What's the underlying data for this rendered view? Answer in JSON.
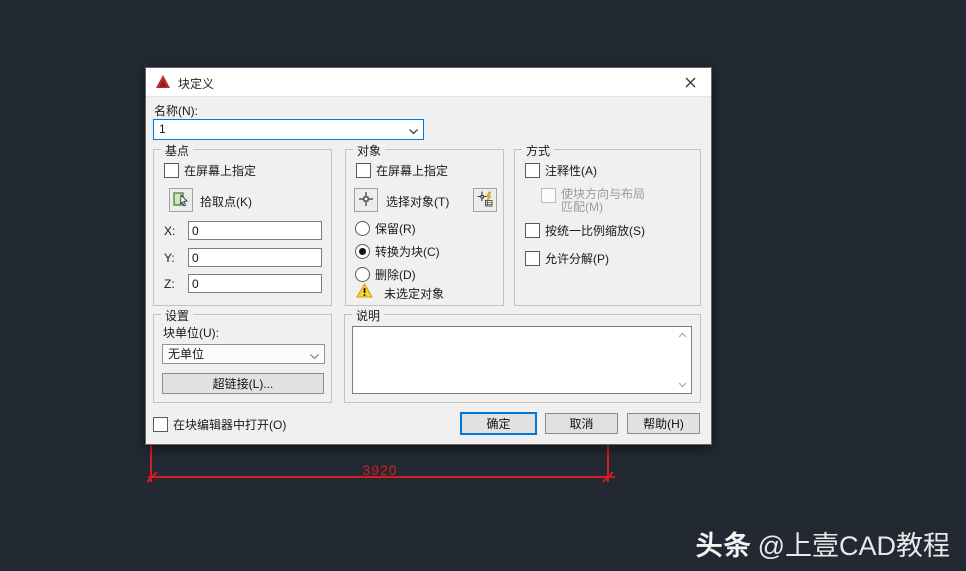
{
  "dialog": {
    "title": "块定义",
    "name_label": "名称(N):",
    "name_value": "1",
    "base_point": {
      "legend": "基点",
      "on_screen": "在屏幕上指定",
      "pick_point": "拾取点(K)",
      "x_label": "X:",
      "x_value": "0",
      "y_label": "Y:",
      "y_value": "0",
      "z_label": "Z:",
      "z_value": "0"
    },
    "objects": {
      "legend": "对象",
      "on_screen": "在屏幕上指定",
      "select_objects": "选择对象(T)",
      "retain": "保留(R)",
      "convert_to_block": "转换为块(C)",
      "delete": "删除(D)",
      "status": "未选定对象"
    },
    "behavior": {
      "legend": "方式",
      "annotative": "注释性(A)",
      "match_orientation_line1": "使块方向与布局",
      "match_orientation_line2": "匹配(M)",
      "uniform_scale": "按统一比例缩放(S)",
      "allow_explode": "允许分解(P)"
    },
    "settings": {
      "legend": "设置",
      "block_unit_label": "块单位(U):",
      "block_unit_value": "无单位",
      "hyperlink_button": "超链接(L)..."
    },
    "description": {
      "legend": "说明",
      "value": ""
    },
    "open_in_block_editor": "在块编辑器中打开(O)",
    "buttons": {
      "ok": "确定",
      "cancel": "取消",
      "help": "帮助(H)"
    },
    "accent_color": "#0078d7"
  },
  "canvas": {
    "dimension_text": "3920",
    "dimension_color": "#d51d1d",
    "background_color": "#222933",
    "warning_color": "#ffd42a"
  },
  "watermark": {
    "brand": "头条",
    "handle": "@上壹CAD教程"
  }
}
